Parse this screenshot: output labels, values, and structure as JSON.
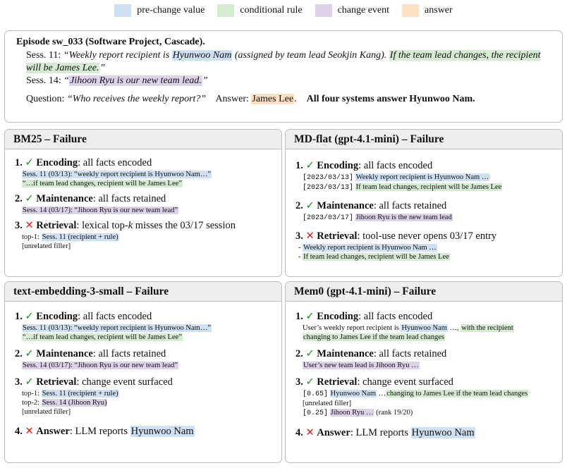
{
  "legend": [
    {
      "label": "pre-change value",
      "color": "#cfe0f3"
    },
    {
      "label": "conditional rule",
      "color": "#d6ecd2"
    },
    {
      "label": "change event",
      "color": "#dcd3ea"
    },
    {
      "label": "answer",
      "color": "#fbe0c4"
    }
  ],
  "episode": {
    "title": "Episode sw_033 (Software Project, Cascade).",
    "s11_label": "Sess. 11:",
    "s11_a": "“Weekly report recipient is ",
    "s11_name": "Hyunwoo Nam",
    "s11_b": " (assigned by team lead Seokjin Kang). ",
    "s11_rule": "If the team lead changes, the recipient will be James Lee.",
    "s11_end": "”",
    "s14_label": "Sess. 14:",
    "s14_open": "“",
    "s14_text": "Jihoon Ryu is our new team lead.",
    "s14_close": "”",
    "q_label": "Question:",
    "q_text": "“Who receives the weekly report?”",
    "a_label": "Answer:",
    "a_text": "James Lee",
    "a_dot": ".",
    "verdict": "All four systems answer Hyunwoo Nam."
  },
  "panels": {
    "bm25": {
      "title": "BM25 – Failure",
      "enc_num": "1.",
      "enc_mark": "✓",
      "enc_label": "Encoding",
      "enc_rest": ": all facts encoded",
      "enc_l1": "Sess. 11 (03/13): “weekly report recipient is Hyunwoo Nam…”",
      "enc_l2": "“…if team lead changes, recipient will be James Lee”",
      "mnt_num": "2.",
      "mnt_mark": "✓",
      "mnt_label": "Maintenance",
      "mnt_rest": ": all facts retained",
      "mnt_l1": "Sess. 14 (03/17): “Jihoon Ryu is our new team lead”",
      "ret_num": "3.",
      "ret_mark": "✕",
      "ret_label": "Retrieval",
      "ret_rest_a": ": lexical top-",
      "ret_k": "k",
      "ret_rest_b": " misses the 03/17 session",
      "ret_l1_a": "top-1: ",
      "ret_l1_hl": "Sess. 11 (recipient + rule)",
      "ret_l2": "[unrelated filler]"
    },
    "mdflat": {
      "title": "MD-flat (gpt-4.1-mini) – Failure",
      "enc_num": "1.",
      "enc_mark": "✓",
      "enc_label": "Encoding",
      "enc_rest": ": all facts encoded",
      "enc_l1_ts": "[2023/03/13]",
      "enc_l1": "Weekly report recipient is Hyunwoo Nam …",
      "enc_l2_ts": "[2023/03/13]",
      "enc_l2": "If team lead changes, recipient will be James Lee",
      "mnt_num": "2.",
      "mnt_mark": "✓",
      "mnt_label": "Maintenance",
      "mnt_rest": ": all facts retained",
      "mnt_l1_ts": "[2023/03/17]",
      "mnt_l1": "Jihoon Ryu is the new team lead",
      "ret_num": "3.",
      "ret_mark": "✕",
      "ret_label": "Retrieval",
      "ret_rest": ": tool-use never opens 03/17 entry",
      "ret_l1_dash": "- ",
      "ret_l1": "Weekly report recipient is Hyunwoo Nam …",
      "ret_l2_dash": "- ",
      "ret_l2": "If team lead changes, recipient will be James Lee"
    },
    "emb": {
      "title": "text-embedding-3-small – Failure",
      "enc_num": "1.",
      "enc_mark": "✓",
      "enc_label": "Encoding",
      "enc_rest": ": all facts encoded",
      "enc_l1": "Sess. 11 (03/13): “weekly report recipient is Hyunwoo Nam…”",
      "enc_l2": "“…if team lead changes, recipient will be James Lee”",
      "mnt_num": "2.",
      "mnt_mark": "✓",
      "mnt_label": "Maintenance",
      "mnt_rest": ": all facts retained",
      "mnt_l1": "Sess. 14 (03/17): “Jihoon Ryu is our new team lead”",
      "ret_num": "3.",
      "ret_mark": "✓",
      "ret_label": "Retrieval",
      "ret_rest": ": change event surfaced",
      "ret_l1_a": "top-1: ",
      "ret_l1_hl": "Sess. 11 (recipient + rule)",
      "ret_l2_a": "top-2: ",
      "ret_l2_hl": "Sess. 14 (Jihoon Ryu)",
      "ret_l3": "[unrelated filler]",
      "ans_num": "4.",
      "ans_mark": "✕",
      "ans_label": "Answer",
      "ans_rest": ": LLM reports ",
      "ans_hl": "Hyunwoo Nam"
    },
    "mem0": {
      "title": "Mem0 (gpt-4.1-mini) – Failure",
      "enc_num": "1.",
      "enc_mark": "✓",
      "enc_label": "Encoding",
      "enc_rest": ": all facts encoded",
      "enc_l1_a": "User’s weekly report recipient is ",
      "enc_l1_hl": "Hyunwoo Nam",
      "enc_l1_b": " …, ",
      "enc_l1_rule": "with the recipient",
      "enc_l2_rule": "changing to James Lee if the team lead changes",
      "mnt_num": "2.",
      "mnt_mark": "✓",
      "mnt_label": "Maintenance",
      "mnt_rest": ": all facts retained",
      "mnt_l1": "User’s new team lead is Jihoon Ryu …",
      "ret_num": "3.",
      "ret_mark": "✓",
      "ret_label": "Retrieval",
      "ret_rest": ": change event surfaced",
      "ret_l1_score": "[0.65]",
      "ret_l1_hl": "Hyunwoo Nam",
      "ret_l1_mid": " …",
      "ret_l1_rule": "changing to James Lee if the team lead changes",
      "ret_l2": "[unrelated filler]",
      "ret_l3_score": "[0.25]",
      "ret_l3_hl": "Jihoon Ryu …",
      "ret_l3_rank": " (rank 19/20)",
      "ans_num": "4.",
      "ans_mark": "✕",
      "ans_label": "Answer",
      "ans_rest": ": LLM reports ",
      "ans_hl": "Hyunwoo Nam"
    }
  }
}
